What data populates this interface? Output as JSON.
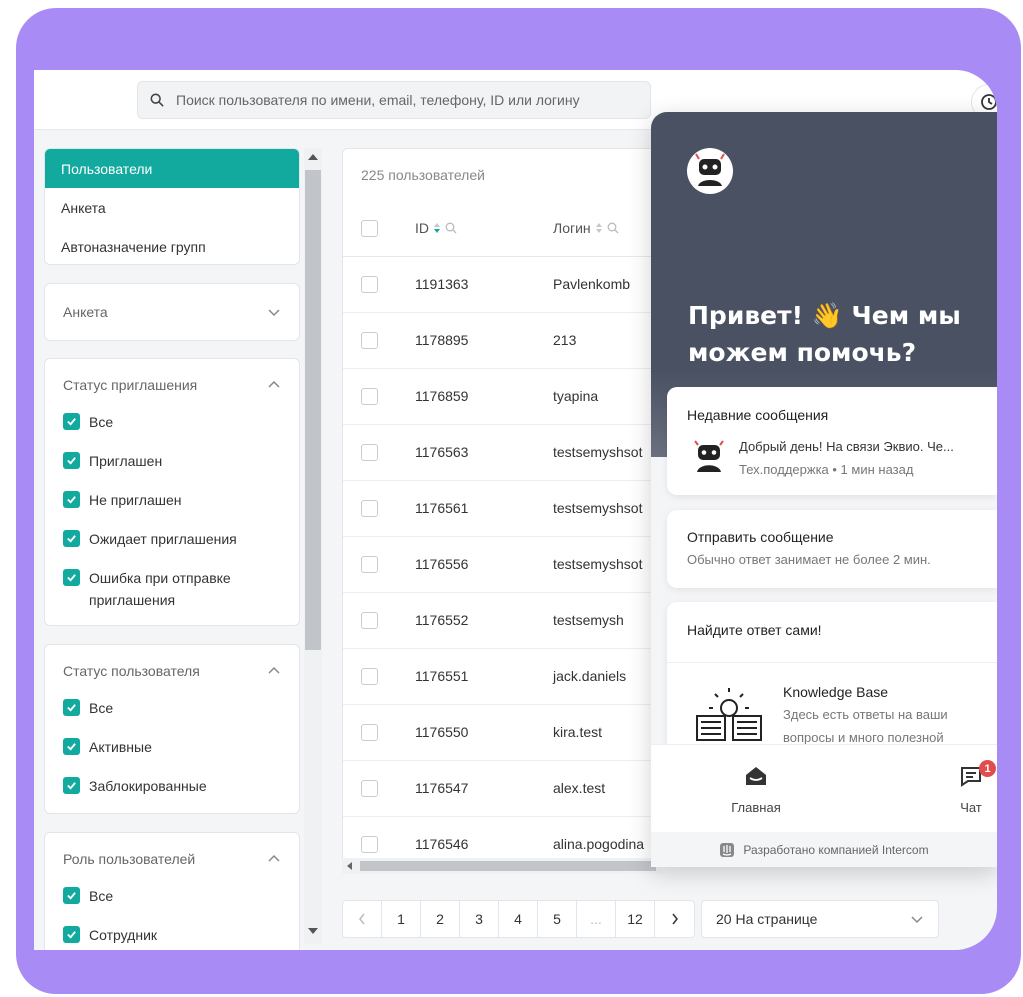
{
  "search": {
    "placeholder": "Поиск пользователя по имени, email, телефону, ID или логину"
  },
  "sidebar": {
    "nav": [
      "Пользователи",
      "Анкета",
      "Автоназначение групп"
    ],
    "anketa_filter": "Анкета",
    "invite_status": {
      "title": "Статус приглашения",
      "options": [
        "Все",
        "Приглашен",
        "Не приглашен",
        "Ожидает приглашения",
        "Ошибка при отправке приглашения"
      ]
    },
    "user_status": {
      "title": "Статус пользователя",
      "options": [
        "Все",
        "Активные",
        "Заблокированные"
      ]
    },
    "user_role": {
      "title": "Роль пользователей",
      "options": [
        "Все",
        "Сотрудник"
      ]
    }
  },
  "table": {
    "count": "225 пользователей",
    "columns": {
      "id": "ID",
      "login": "Логин"
    },
    "rows": [
      {
        "id": "1191363",
        "login": "Pavlenkomb"
      },
      {
        "id": "1178895",
        "login": "213"
      },
      {
        "id": "1176859",
        "login": "tyapina"
      },
      {
        "id": "1176563",
        "login": "testsemyshsot"
      },
      {
        "id": "1176561",
        "login": "testsemyshsot"
      },
      {
        "id": "1176556",
        "login": "testsemyshsot"
      },
      {
        "id": "1176552",
        "login": "testsemysh"
      },
      {
        "id": "1176551",
        "login": "jack.daniels"
      },
      {
        "id": "1176550",
        "login": "kira.test"
      },
      {
        "id": "1176547",
        "login": "alex.test"
      },
      {
        "id": "1176546",
        "login": "alina.pogodina"
      }
    ]
  },
  "pagination": {
    "pages": [
      "1",
      "2",
      "3",
      "4",
      "5",
      "...",
      "12"
    ],
    "per_page": "20 На странице"
  },
  "widget": {
    "greeting": "Привет! 👋 Чем мы можем помочь?",
    "recent": {
      "title": "Недавние сообщения",
      "message": "Добрый день! На связи Эквио. Че...",
      "meta": "Тех.поддержка • 1 мин назад"
    },
    "send": {
      "title": "Отправить сообщение",
      "subtitle": "Обычно ответ занимает не более 2 мин."
    },
    "find": {
      "title": "Найдите ответ сами!",
      "kb_title": "Knowledge Base",
      "kb_desc_1": "Здесь есть ответы на ваши",
      "kb_desc_2": "вопросы и много полезной"
    },
    "nav": {
      "home": "Главная",
      "chat": "Чат",
      "chat_badge": "1"
    },
    "footer": "Разработано компанией Intercom"
  },
  "colors": {
    "accent": "#12a99f",
    "frame": "#a98bf5",
    "widget_header": "#4a5162",
    "badge": "#e24c4c"
  }
}
